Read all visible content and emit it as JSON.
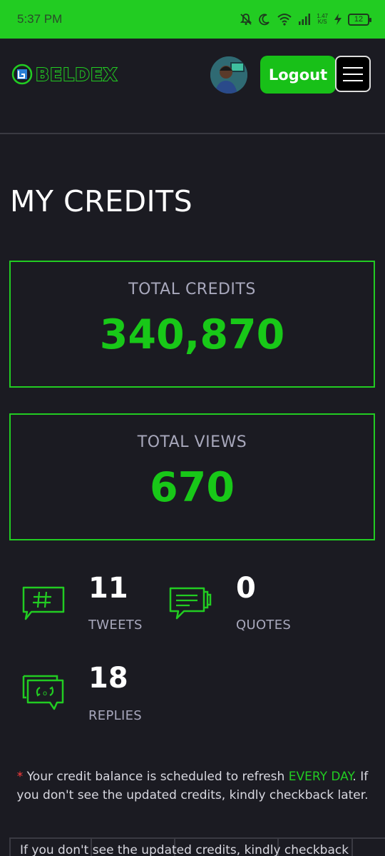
{
  "status_bar": {
    "time": "5:37 PM",
    "net_speed_value": "1.47",
    "net_speed_unit": "K/S",
    "battery": "12",
    "bar_color": "#22cc22"
  },
  "header": {
    "logo_text": "BELDEX",
    "logout_label": "Logout"
  },
  "page": {
    "title": "MY CREDITS"
  },
  "stats": {
    "total_credits_label": "TOTAL CREDITS",
    "total_credits_value": "340,870",
    "total_views_label": "TOTAL VIEWS",
    "total_views_value": "670"
  },
  "activity": {
    "tweets": {
      "count": "11",
      "label": "TWEETS",
      "icon": "hashtag-chat-icon"
    },
    "quotes": {
      "count": "0",
      "label": "QUOTES",
      "icon": "quote-chat-icon"
    },
    "replies": {
      "count": "18",
      "label": "REPLIES",
      "icon": "reply-chat-icon"
    }
  },
  "notice": {
    "star": "*",
    "before": " Your credit balance is scheduled to refresh ",
    "highlight": "EVERY DAY",
    "after": ". If you don't see the updated credits, kindly checkback later."
  },
  "bottom_text": "If you don't see the updated credits, kindly checkback",
  "colors": {
    "accent": "#22cc22",
    "background": "#1b1b22",
    "label_gray": "#a8a8bc"
  }
}
